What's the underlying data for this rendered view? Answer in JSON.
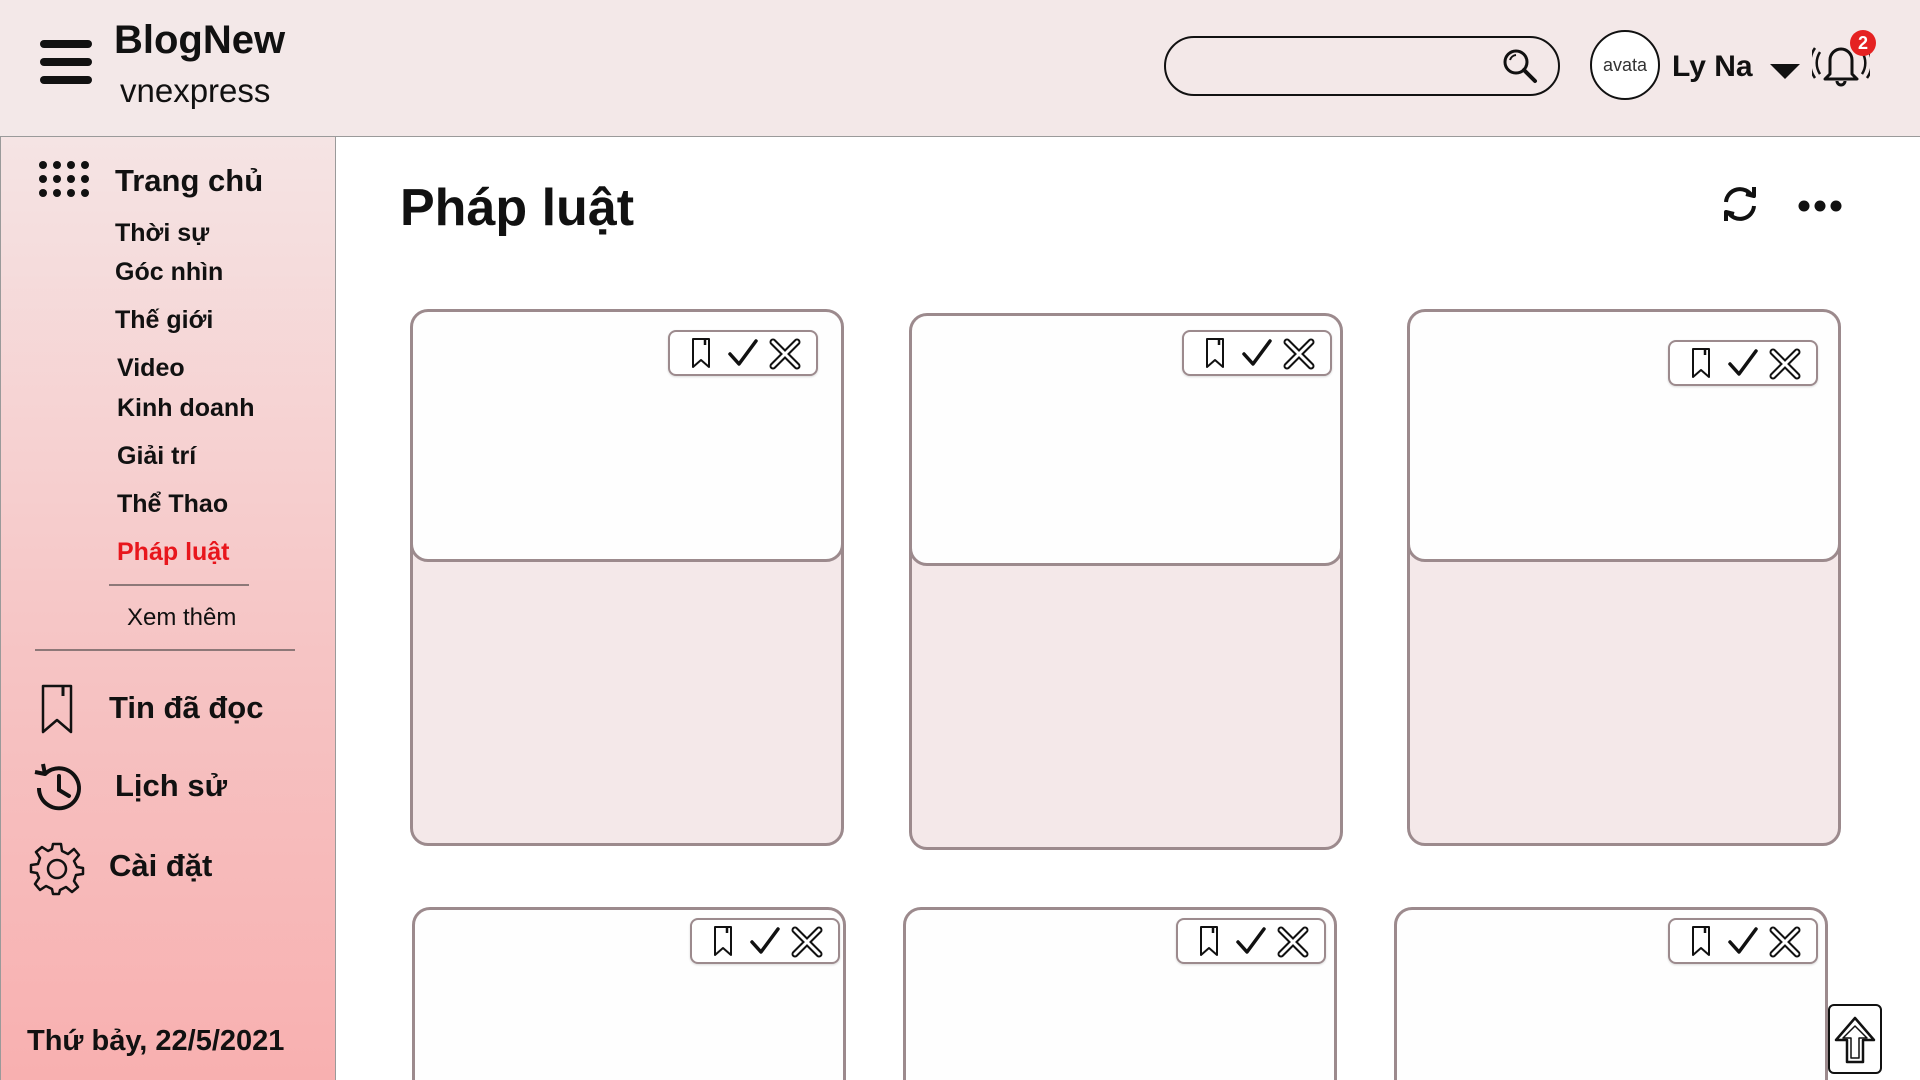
{
  "header": {
    "brand_title": "BlogNew",
    "brand_subtitle": "vnexpress",
    "search_placeholder": "",
    "avatar_text": "avata",
    "username": "Ly Na",
    "notification_count": "2"
  },
  "sidebar": {
    "home_label": "Trang chủ",
    "categories": [
      {
        "label": "Thời sự"
      },
      {
        "label": "Góc nhìn"
      },
      {
        "label": "Thế giới"
      },
      {
        "label": "Video"
      },
      {
        "label": "Kinh doanh"
      },
      {
        "label": "Giải trí"
      },
      {
        "label": "Thể Thao"
      },
      {
        "label": "Pháp luật",
        "active": true
      }
    ],
    "more_label": "Xem thêm",
    "links": [
      {
        "label": "Tin đã đọc",
        "icon": "bookmark-icon"
      },
      {
        "label": "Lịch sử",
        "icon": "history-icon"
      },
      {
        "label": "Cài đặt",
        "icon": "gear-icon"
      }
    ],
    "date": "Thứ bảy, 22/5/2021"
  },
  "main": {
    "title": "Pháp luật",
    "card_actions": [
      "bookmark-icon",
      "check-icon",
      "close-icon"
    ],
    "card_count": 6
  },
  "colors": {
    "header_bg": "#f3e8e8",
    "active_category": "#e8161c",
    "badge": "#e52222",
    "card_border": "#9c8a8d",
    "card_body": "#f4e8e9"
  }
}
